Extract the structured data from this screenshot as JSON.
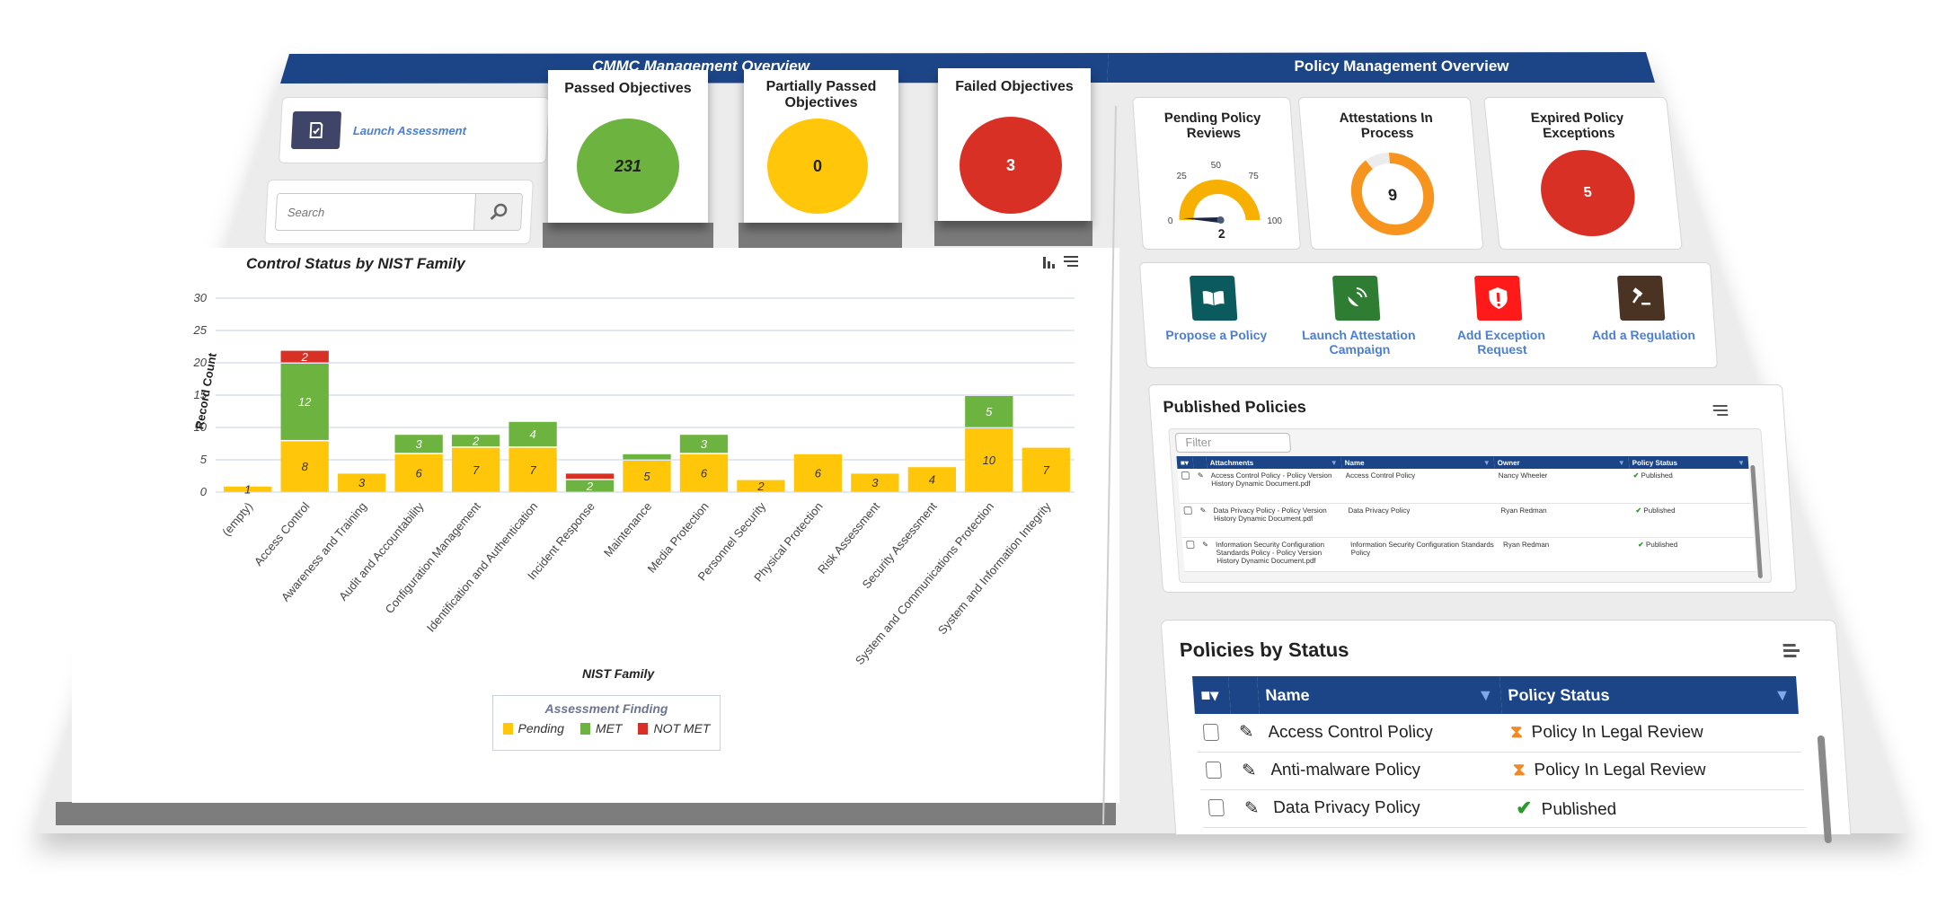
{
  "cmmc": {
    "header_title": "CMMC Management Overview",
    "launch_assessment_label": "Launch Assessment",
    "search_placeholder": "Search",
    "objectives": [
      {
        "title": "Passed Objectives",
        "value": "231",
        "color": "#6db33f"
      },
      {
        "title": "Partially Passed Objectives",
        "value": "0",
        "color": "#ffc60a"
      },
      {
        "title": "Failed Objectives",
        "value": "3",
        "color": "#d93025"
      }
    ]
  },
  "chart_data": {
    "type": "bar",
    "stacked": true,
    "title": "Control Status by NIST Family",
    "xlabel": "NIST Family",
    "ylabel": "Record Count",
    "ylim": [
      0,
      30
    ],
    "yticks": [
      0,
      5,
      10,
      15,
      20,
      25,
      30
    ],
    "grid": true,
    "legend": {
      "title": "Assessment Finding",
      "placement": "bottom-center"
    },
    "categories": [
      "(empty)",
      "Access Control",
      "Awareness and Training",
      "Audit and Accountability",
      "Configuration Management",
      "Identification and Authentication",
      "Incident Response",
      "Maintenance",
      "Media Protection",
      "Personnel Security",
      "Physical Protection",
      "Risk Assessment",
      "Security Assessment",
      "System and Communications Protection",
      "System and Information Integrity"
    ],
    "series": [
      {
        "name": "Pending",
        "color": "#ffc60a",
        "values": [
          1,
          8,
          3,
          6,
          7,
          7,
          0,
          5,
          6,
          2,
          6,
          3,
          4,
          10,
          7
        ]
      },
      {
        "name": "MET",
        "color": "#6db33f",
        "values": [
          0,
          12,
          0,
          3,
          2,
          4,
          2,
          1,
          3,
          0,
          0,
          0,
          0,
          5,
          0
        ]
      },
      {
        "name": "NOT MET",
        "color": "#d93025",
        "values": [
          0,
          2,
          0,
          0,
          0,
          0,
          1,
          0,
          0,
          0,
          0,
          0,
          0,
          0,
          0
        ]
      }
    ],
    "data_labels": [
      [
        "1",
        "",
        ""
      ],
      [
        "8",
        "12",
        "2"
      ],
      [
        "3",
        "",
        ""
      ],
      [
        "6",
        "3",
        ""
      ],
      [
        "7",
        "2",
        ""
      ],
      [
        "7",
        "4",
        ""
      ],
      [
        "",
        "2",
        ""
      ],
      [
        "5",
        "",
        ""
      ],
      [
        "6",
        "3",
        ""
      ],
      [
        "2",
        "",
        ""
      ],
      [
        "6",
        "",
        ""
      ],
      [
        "3",
        "",
        ""
      ],
      [
        "4",
        "",
        ""
      ],
      [
        "10",
        "5",
        ""
      ],
      [
        "7",
        "",
        ""
      ]
    ]
  },
  "policy": {
    "header_title": "Policy Management Overview",
    "pending_reviews": {
      "title": "Pending Policy Reviews",
      "value": "2",
      "gauge_ticks": [
        "0",
        "25",
        "50",
        "75",
        "100"
      ],
      "gauge_max": 100,
      "gauge_color": "#f8b000"
    },
    "attestations": {
      "title": "Attestations In Process",
      "value": "9",
      "ring_fill_fraction": 0.9,
      "ring_color": "#f7941d"
    },
    "expired_exceptions": {
      "title": "Expired Policy Exceptions",
      "value": "5",
      "color": "#d93025"
    },
    "actions": [
      {
        "label": "Propose a Policy",
        "icon": "book-icon",
        "color": "#0b5a5e"
      },
      {
        "label": "Launch Attestation Campaign",
        "icon": "satellite-dish-icon",
        "color": "#2e7d32"
      },
      {
        "label": "Add Exception Request",
        "icon": "shield-alert-icon",
        "color": "#ff1a1a"
      },
      {
        "label": "Add a Regulation",
        "icon": "gavel-icon",
        "color": "#4a3322"
      }
    ],
    "published": {
      "title": "Published Policies",
      "filter_placeholder": "Filter",
      "columns": [
        "Attachments",
        "Name",
        "Owner",
        "Policy Status"
      ],
      "rows": [
        {
          "attachment": "Access Control Policy - Policy Version History Dynamic Document.pdf",
          "name": "Access Control Policy",
          "owner": "Nancy Wheeler",
          "status": "Published"
        },
        {
          "attachment": "Data Privacy Policy - Policy Version History Dynamic Document.pdf",
          "name": "Data Privacy Policy",
          "owner": "Ryan Redman",
          "status": "Published"
        },
        {
          "attachment": "Information Security Configuration Standards Policy - Policy Version History Dynamic Document.pdf",
          "name": "Information Security Configuration Standards Policy",
          "owner": "Ryan Redman",
          "status": "Published"
        }
      ]
    },
    "by_status": {
      "title": "Policies by Status",
      "columns": [
        "Name",
        "Policy Status"
      ],
      "rows": [
        {
          "name": "Access Control Policy",
          "status": "Policy In Legal Review",
          "status_icon": "hourglass-icon"
        },
        {
          "name": "Anti-malware Policy",
          "status": "Policy In Legal Review",
          "status_icon": "hourglass-icon"
        },
        {
          "name": "Data Privacy Policy",
          "status": "Published",
          "status_icon": "check-icon"
        }
      ]
    }
  }
}
